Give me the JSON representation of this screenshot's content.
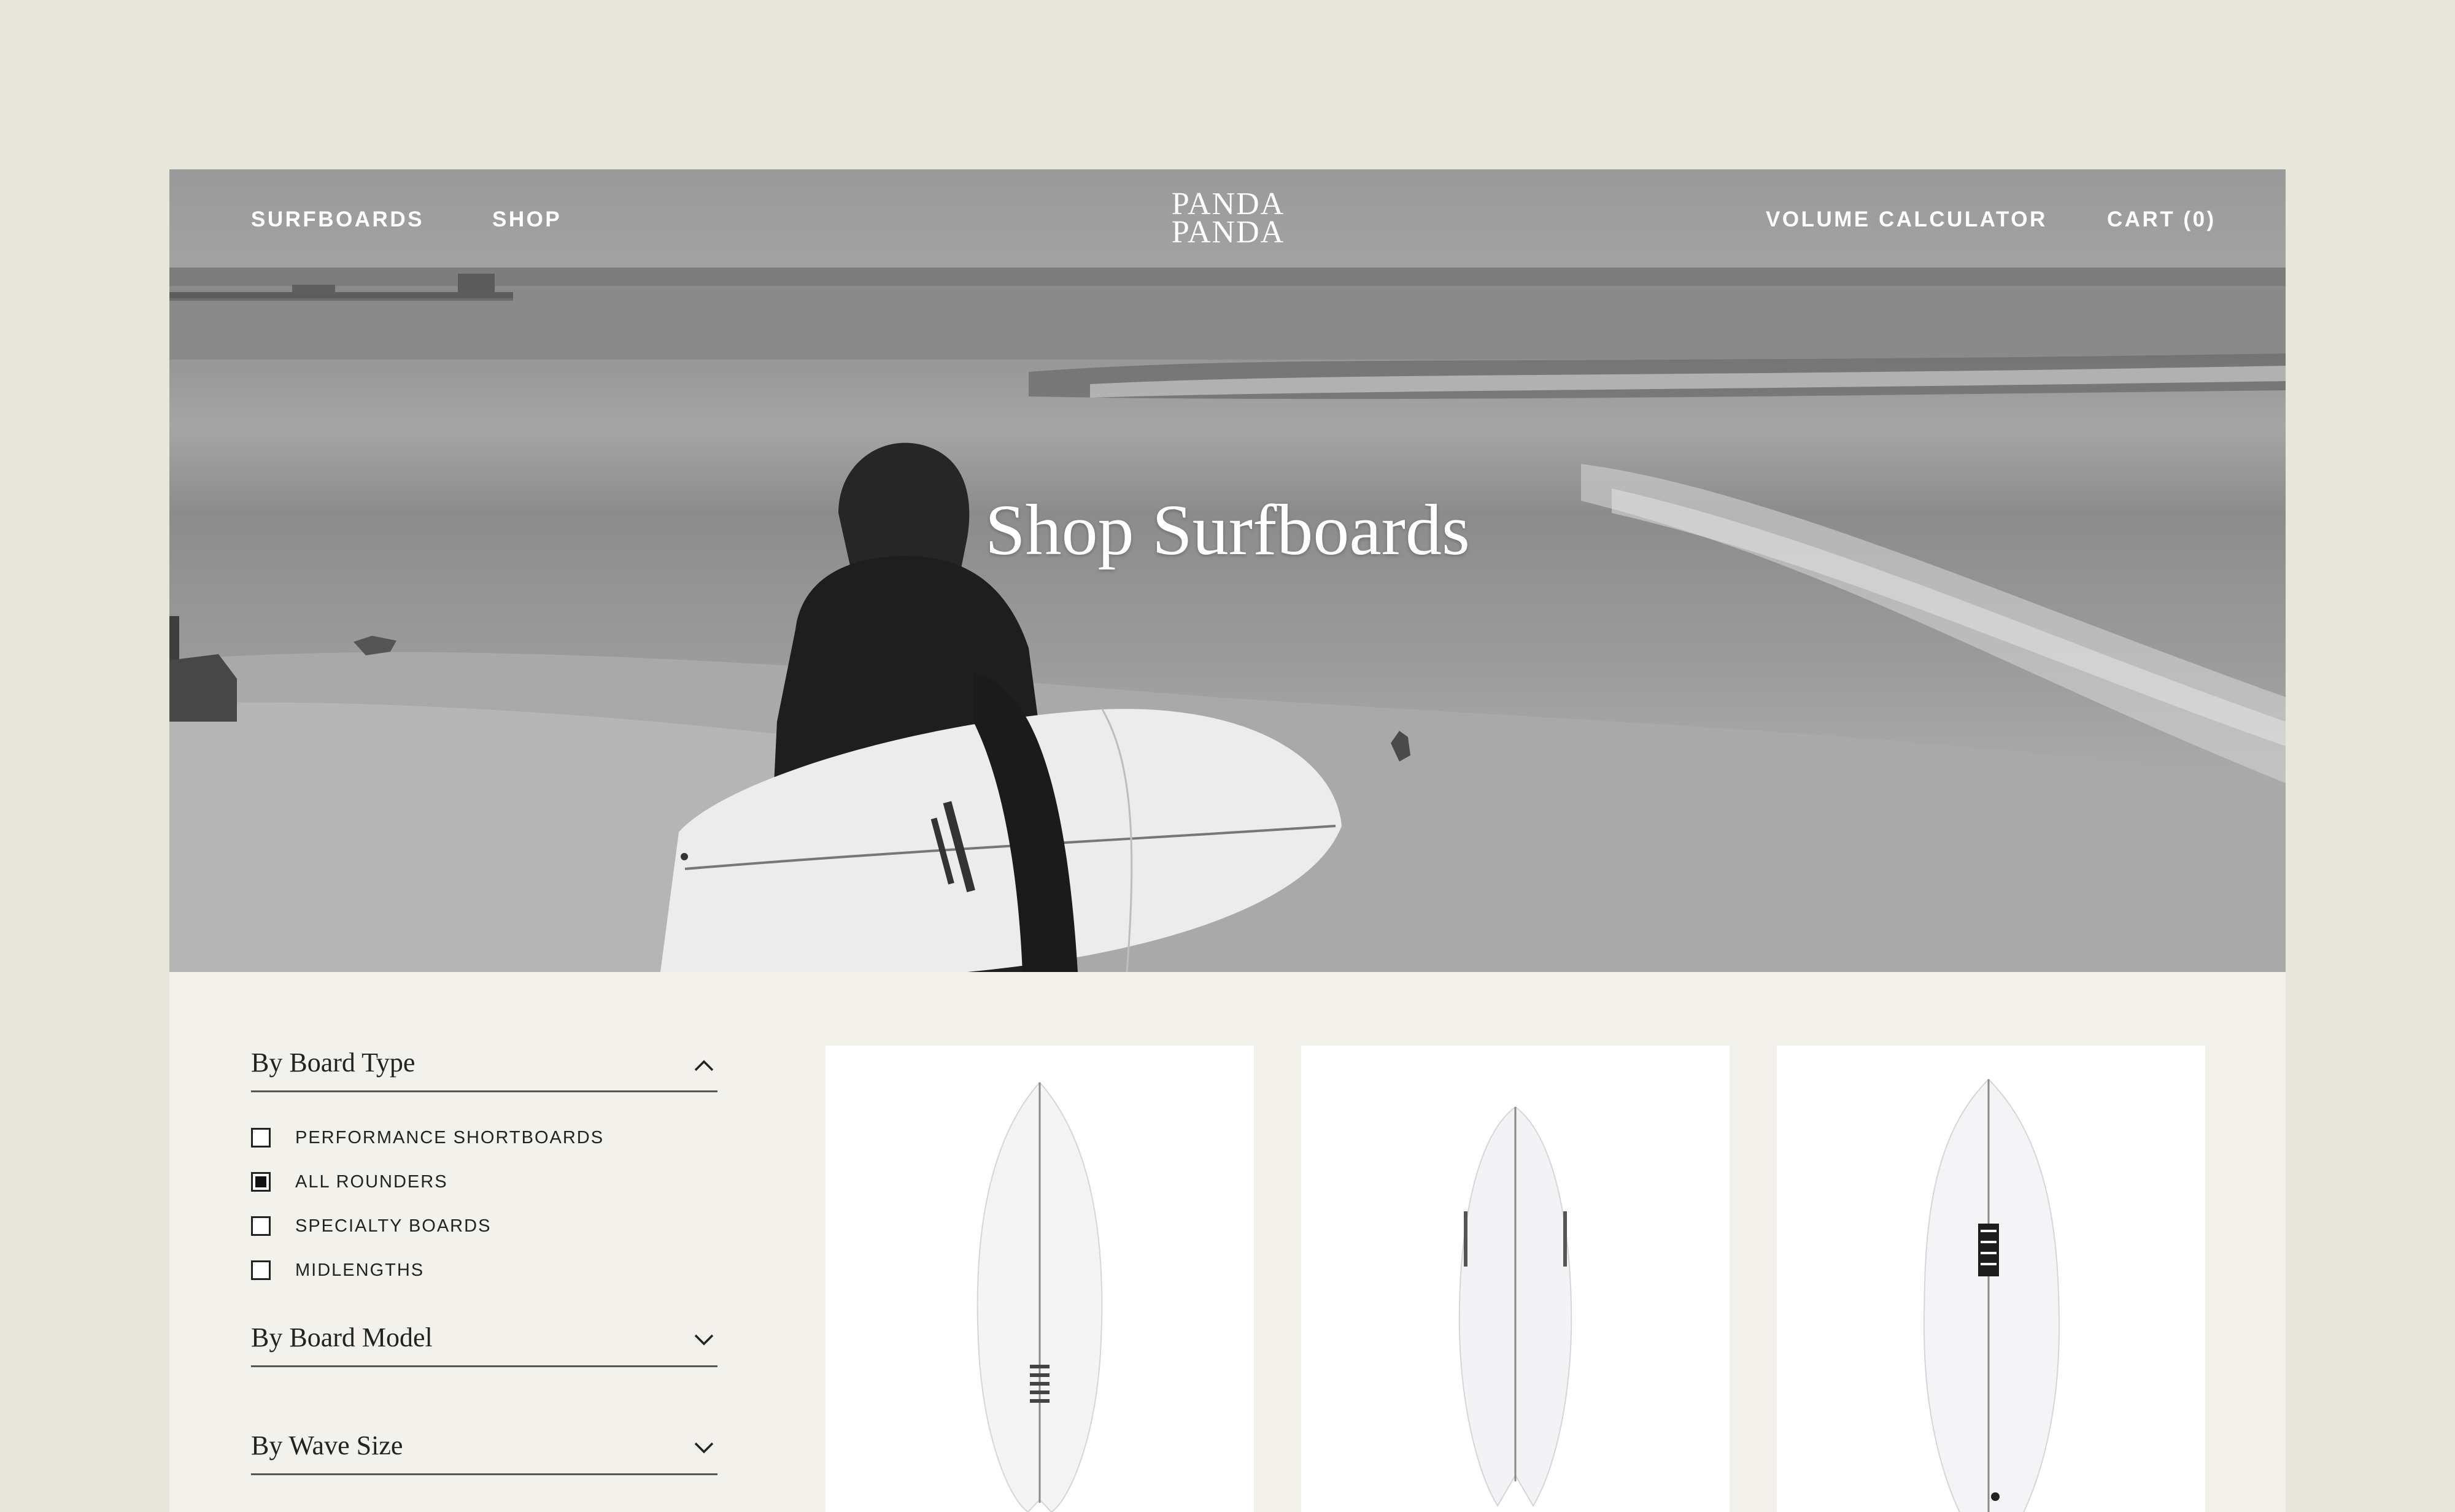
{
  "nav": {
    "left": [
      "SURFBOARDS",
      "SHOP"
    ],
    "right": [
      "VOLUME CALCULATOR",
      "CART (0)"
    ],
    "logo_lines": [
      "PANDA",
      "PANDA"
    ]
  },
  "hero": {
    "title": "Shop Surfboards"
  },
  "filters": [
    {
      "title": "By Board Type",
      "expanded": true,
      "icon": "chevron-up-icon",
      "options": [
        {
          "label": "PERFORMANCE SHORTBOARDS",
          "checked": false
        },
        {
          "label": "ALL ROUNDERS",
          "checked": true
        },
        {
          "label": "SPECIALTY BOARDS",
          "checked": false
        },
        {
          "label": "MIDLENGTHS",
          "checked": false
        }
      ]
    },
    {
      "title": "By Board Model",
      "expanded": false,
      "icon": "chevron-down-icon"
    },
    {
      "title": "By Wave Size",
      "expanded": false,
      "icon": "chevron-down-icon"
    }
  ],
  "products": [
    {
      "image": "surfboard-swallowtail-image"
    },
    {
      "image": "surfboard-fish-image"
    },
    {
      "image": "surfboard-round-nose-image"
    }
  ],
  "colors": {
    "page_bg": "#e8e6dc",
    "panel_bg": "#f3f1ec",
    "text": "#222222",
    "hero_text": "#ffffff"
  }
}
